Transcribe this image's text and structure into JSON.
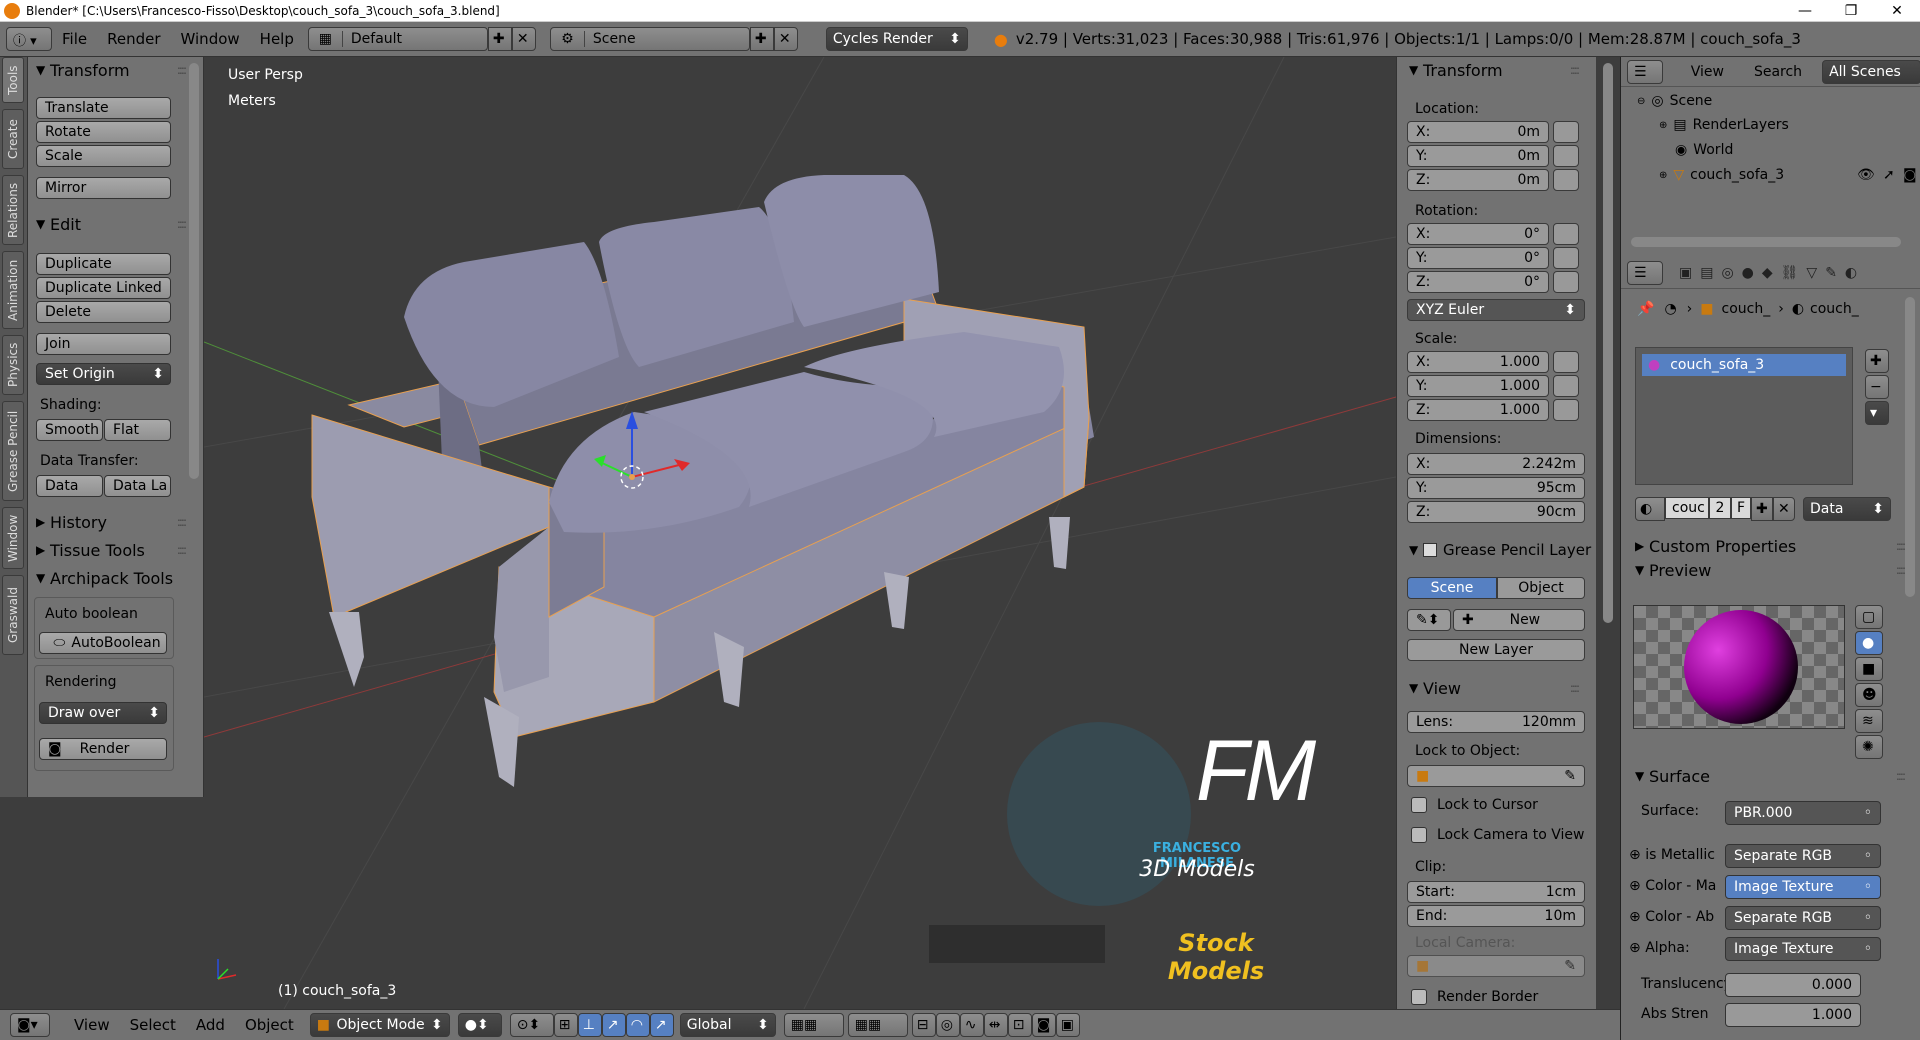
{
  "window": {
    "title": "Blender* [C:\\Users\\Francesco-Fisso\\Desktop\\couch_sofa_3\\couch_sofa_3.blend]",
    "min": "—",
    "max": "❐",
    "close": "✕"
  },
  "infobar": {
    "menus": [
      "File",
      "Render",
      "Window",
      "Help"
    ],
    "layout": "Default",
    "scene": "Scene",
    "engine": "Cycles Render",
    "stats": "v2.79 | Verts:31,023 | Faces:30,988 | Tris:61,976 | Objects:1/1 | Lamps:0/0 | Mem:28.87M | couch_sofa_3"
  },
  "lefttabs": [
    "Tools",
    "Create",
    "Relations",
    "Animation",
    "Physics",
    "Grease Pencil",
    "Window",
    "Graswald"
  ],
  "toolshelf": {
    "transform_title": "Transform",
    "translate": "Translate",
    "rotate": "Rotate",
    "scale": "Scale",
    "mirror": "Mirror",
    "edit_title": "Edit",
    "duplicate": "Duplicate",
    "duplicate_linked": "Duplicate Linked",
    "delete": "Delete",
    "join": "Join",
    "set_origin": "Set Origin",
    "shading_label": "Shading:",
    "smooth": "Smooth",
    "flat": "Flat",
    "data_transfer_label": "Data Transfer:",
    "data": "Data",
    "data_la": "Data La",
    "history": "History",
    "tissue": "Tissue Tools",
    "archipack": "Archipack Tools",
    "auto_boolean_label": "Auto boolean",
    "autoboolean": "AutoBoolean",
    "rendering_label": "Rendering",
    "draw_over": "Draw over",
    "render": "Render"
  },
  "viewport": {
    "view_name": "User Persp",
    "units": "Meters",
    "object_label": "(1) couch_sofa_3",
    "watermark_big": "FM",
    "watermark_name": "FRANCESCO MILANESE",
    "watermark_sub": "3D Models",
    "watermark_stock": "Stock Models"
  },
  "npanel": {
    "transform_title": "Transform",
    "location_label": "Location:",
    "location": [
      {
        "k": "X:",
        "v": "0m"
      },
      {
        "k": "Y:",
        "v": "0m"
      },
      {
        "k": "Z:",
        "v": "0m"
      }
    ],
    "rotation_label": "Rotation:",
    "rotation": [
      {
        "k": "X:",
        "v": "0°"
      },
      {
        "k": "Y:",
        "v": "0°"
      },
      {
        "k": "Z:",
        "v": "0°"
      }
    ],
    "rotation_mode": "XYZ Euler",
    "scale_label": "Scale:",
    "scale": [
      {
        "k": "X:",
        "v": "1.000"
      },
      {
        "k": "Y:",
        "v": "1.000"
      },
      {
        "k": "Z:",
        "v": "1.000"
      }
    ],
    "dimensions_label": "Dimensions:",
    "dimensions": [
      {
        "k": "X:",
        "v": "2.242m"
      },
      {
        "k": "Y:",
        "v": "95cm"
      },
      {
        "k": "Z:",
        "v": "90cm"
      }
    ],
    "gp_title": "Grease Pencil Layer",
    "gp_scene": "Scene",
    "gp_object": "Object",
    "gp_new": "New",
    "gp_new_layer": "New Layer",
    "view_title": "View",
    "lens_k": "Lens:",
    "lens_v": "120mm",
    "lock_obj_label": "Lock to Object:",
    "lock_cursor": "Lock to Cursor",
    "lock_camera": "Lock Camera to View",
    "clip_label": "Clip:",
    "start_k": "Start:",
    "start_v": "1cm",
    "end_k": "End:",
    "end_v": "10m",
    "local_camera": "Local Camera:",
    "render_border": "Render Border"
  },
  "outliner": {
    "view": "View",
    "search": "Search",
    "scope": "All Scenes",
    "items": [
      "Scene",
      "RenderLayers",
      "World",
      "couch_sofa_3"
    ]
  },
  "props": {
    "crumb1": "couch_",
    "crumb2": "couch_",
    "material": "couch_sofa_3",
    "mat_field": "couc",
    "mat_users": "2",
    "mat_f": "F",
    "mat_link": "Data",
    "custom_props": "Custom Properties",
    "preview": "Preview",
    "surface_title": "Surface",
    "surface_k": "Surface:",
    "surface_v": "PBR.000",
    "rows": [
      {
        "k": "is Metallic",
        "v": "Separate RGB"
      },
      {
        "k": "Color - Ma",
        "v": "Image Texture"
      },
      {
        "k": "Color - Ab",
        "v": "Separate RGB"
      },
      {
        "k": "Alpha:",
        "v": "Image Texture"
      }
    ],
    "transl_k": "Translucency",
    "transl_v": "0.000",
    "abs_k": "Abs Stren",
    "abs_v": "1.000"
  },
  "bottombar": {
    "view": "View",
    "select": "Select",
    "add": "Add",
    "object": "Object",
    "mode": "Object Mode",
    "orientation": "Global"
  },
  "colors": {
    "accent": "#5680c2",
    "bg": "#3d3d3d",
    "panel": "#727272",
    "selection_outline": "#e8a050"
  }
}
